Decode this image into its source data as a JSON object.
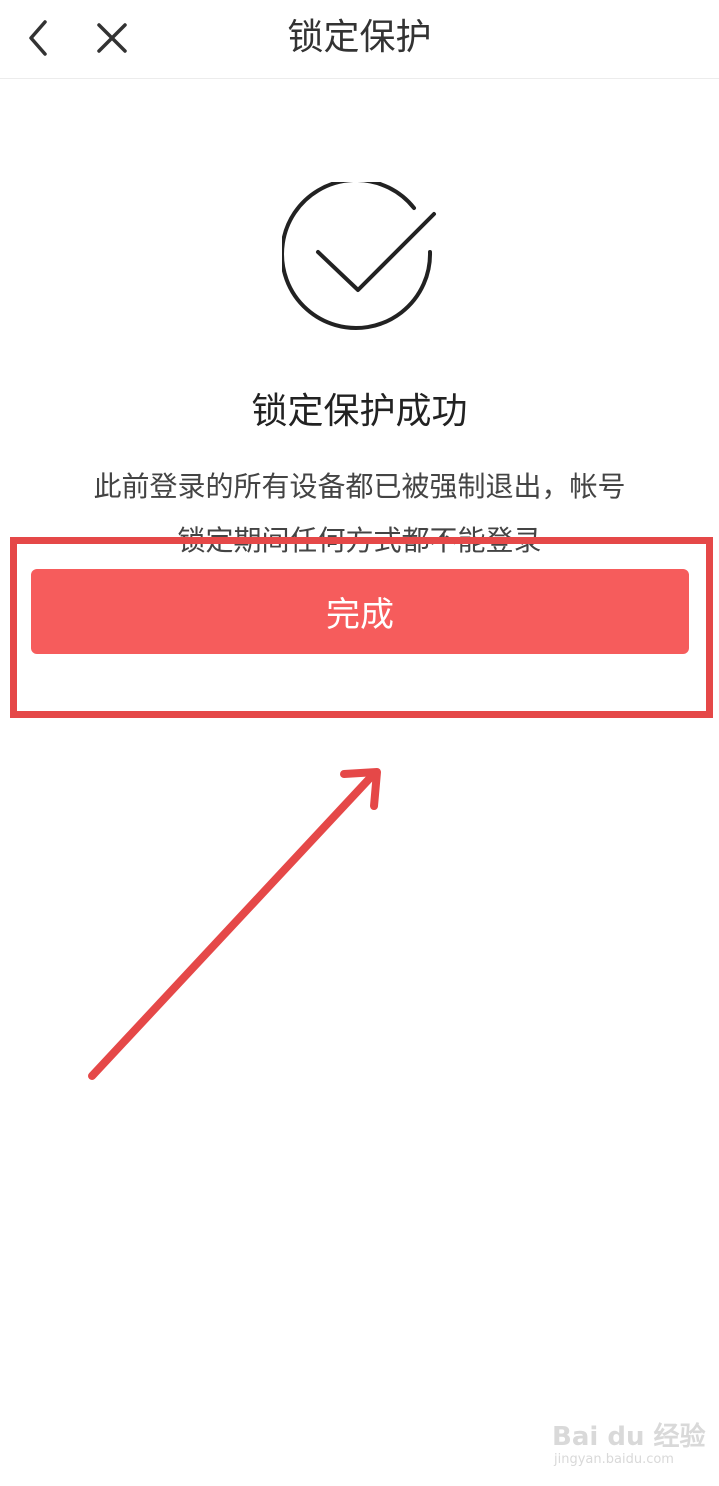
{
  "header": {
    "title": "锁定保护",
    "back_icon": "chevron-left-icon",
    "close_icon": "close-icon"
  },
  "result": {
    "icon": "check-circle-icon",
    "title": "锁定保护成功",
    "description_line1": "此前登录的所有设备都已被强制退出，帐号",
    "description_line2": "锁定期间任何方式都不能登录"
  },
  "actions": {
    "done_label": "完成"
  },
  "watermark": {
    "main": "Bai du 经验",
    "sub": "jingyan.baidu.com"
  },
  "colors": {
    "accent": "#f65c5c",
    "annotation": "#e54848",
    "icon_stroke": "#222222"
  }
}
